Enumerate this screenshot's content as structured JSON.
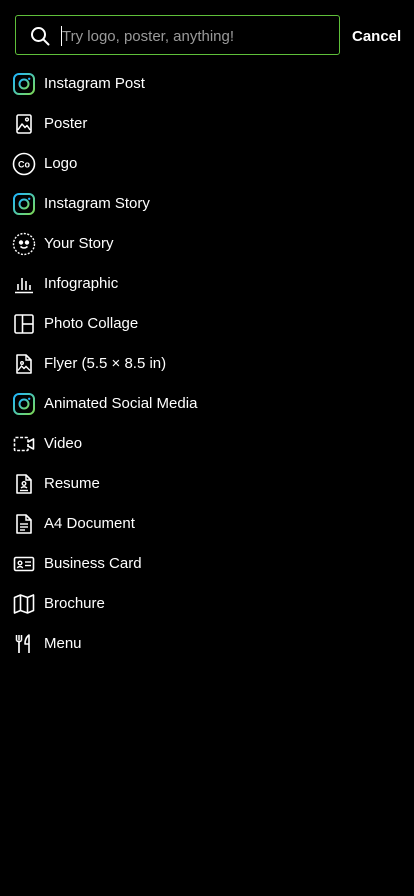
{
  "search": {
    "placeholder": "Try logo, poster, anything!",
    "value": "",
    "cancel_label": "Cancel"
  },
  "colors": {
    "background": "#000000",
    "search_border": "#5fbf3a",
    "text": "#ffffff",
    "placeholder": "#9a9a9a",
    "instagram_ring_start": "#1fb6ff",
    "instagram_ring_end": "#7ed957"
  },
  "items": [
    {
      "label": "Instagram Post",
      "icon": "instagram-post-icon"
    },
    {
      "label": "Poster",
      "icon": "poster-icon"
    },
    {
      "label": "Logo",
      "icon": "logo-icon"
    },
    {
      "label": "Instagram Story",
      "icon": "instagram-story-icon"
    },
    {
      "label": "Your Story",
      "icon": "your-story-icon"
    },
    {
      "label": "Infographic",
      "icon": "infographic-icon"
    },
    {
      "label": "Photo Collage",
      "icon": "photo-collage-icon"
    },
    {
      "label": "Flyer (5.5 × 8.5 in)",
      "icon": "flyer-icon"
    },
    {
      "label": "Animated Social Media",
      "icon": "animated-social-media-icon"
    },
    {
      "label": "Video",
      "icon": "video-icon"
    },
    {
      "label": "Resume",
      "icon": "resume-icon"
    },
    {
      "label": "A4 Document",
      "icon": "document-icon"
    },
    {
      "label": "Business Card",
      "icon": "business-card-icon"
    },
    {
      "label": "Brochure",
      "icon": "brochure-icon"
    },
    {
      "label": "Menu",
      "icon": "menu-icon"
    }
  ]
}
